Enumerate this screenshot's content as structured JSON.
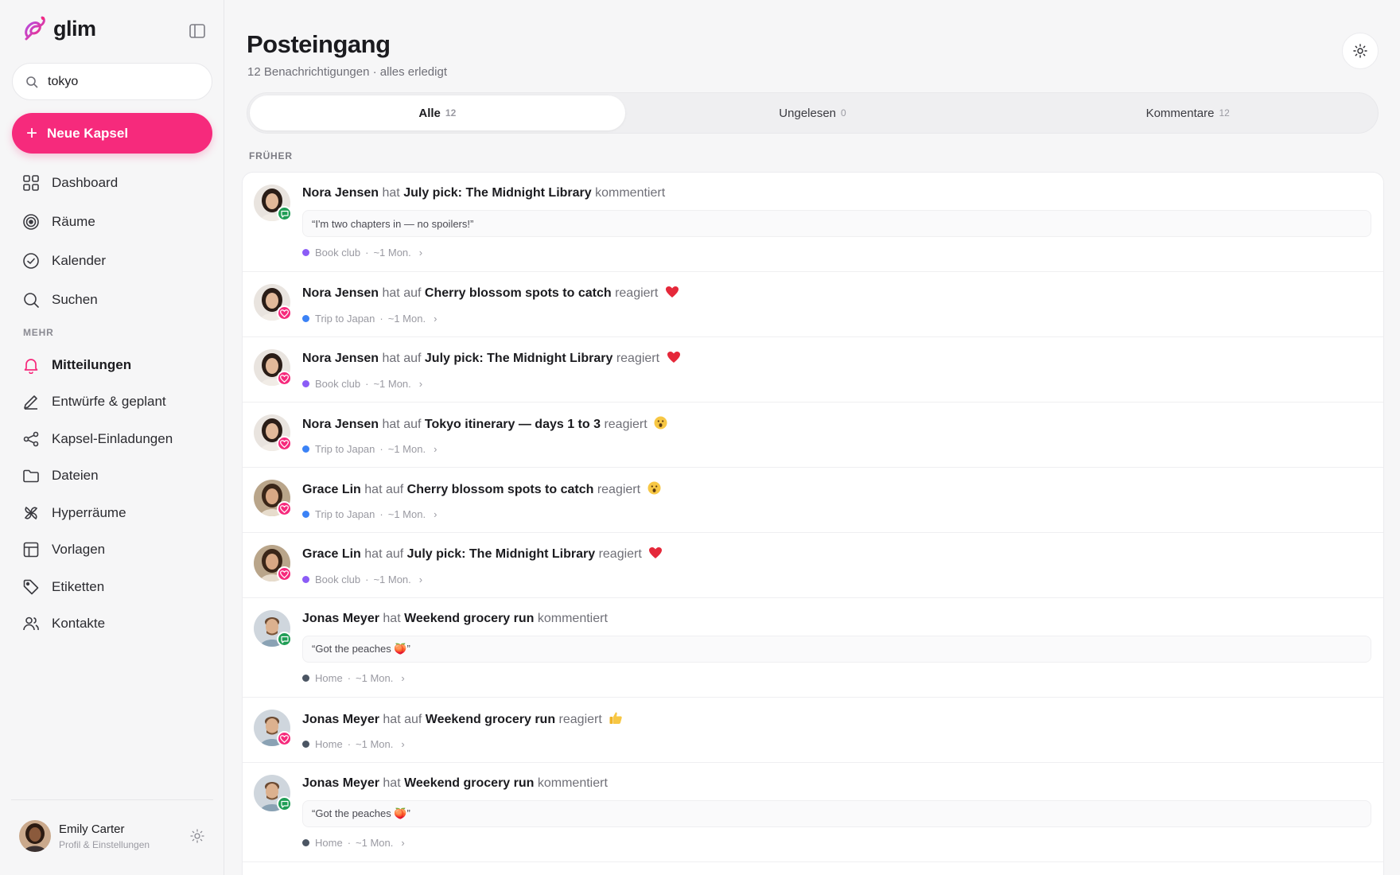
{
  "sidebar": {
    "brand": "glim",
    "search_value": "tokyo",
    "new_label": "Neue Kapsel",
    "items_main": [
      {
        "label": "Dashboard",
        "icon": "grid-icon"
      },
      {
        "label": "Räume",
        "icon": "target-icon"
      },
      {
        "label": "Kalender",
        "icon": "check-circle-icon"
      },
      {
        "label": "Suchen",
        "icon": "search-icon"
      }
    ],
    "section_more": "MEHR",
    "items_more": [
      {
        "label": "Mitteilungen",
        "icon": "bell-icon",
        "active": true
      },
      {
        "label": "Entwürfe & geplant",
        "icon": "pen-icon"
      },
      {
        "label": "Kapsel-Einladungen",
        "icon": "share-icon"
      },
      {
        "label": "Dateien",
        "icon": "folder-icon"
      },
      {
        "label": "Hyperräume",
        "icon": "pinwheel-icon"
      },
      {
        "label": "Vorlagen",
        "icon": "template-icon"
      },
      {
        "label": "Etiketten",
        "icon": "tag-icon"
      },
      {
        "label": "Kontakte",
        "icon": "users-icon"
      }
    ],
    "profile": {
      "name": "Emily Carter",
      "subtitle": "Profil & Einstellungen"
    }
  },
  "main": {
    "title": "Posteingang",
    "subtitle": "12 Benachrichtigungen · alles erledigt",
    "tabs": [
      {
        "label": "Alle",
        "count": "12",
        "active": true
      },
      {
        "label": "Ungelesen",
        "count": "0"
      },
      {
        "label": "Kommentare",
        "count": "12"
      }
    ],
    "group_label": "FRÜHER",
    "notifications": [
      {
        "type": "comment",
        "actor": "Nora Jensen",
        "verb_pre": "hat",
        "target": "July pick: The Midnight Library",
        "verb_post": "kommentiert",
        "emoji": "",
        "quote": "“I'm two chapters in — no spoilers!”",
        "space": "Book club",
        "space_color": "#8b5cf6",
        "time": "~1 Mon.",
        "person": "nora"
      },
      {
        "type": "react",
        "actor": "Nora Jensen",
        "verb_pre": "hat auf",
        "target": "Cherry blossom spots to catch",
        "verb_post": "reagiert",
        "emoji": "heart",
        "space": "Trip to Japan",
        "space_color": "#3b82f6",
        "time": "~1 Mon.",
        "person": "nora"
      },
      {
        "type": "react",
        "actor": "Nora Jensen",
        "verb_pre": "hat auf",
        "target": "July pick: The Midnight Library",
        "verb_post": "reagiert",
        "emoji": "heart",
        "space": "Book club",
        "space_color": "#8b5cf6",
        "time": "~1 Mon.",
        "person": "nora"
      },
      {
        "type": "react",
        "actor": "Nora Jensen",
        "verb_pre": "hat auf",
        "target": "Tokyo itinerary — days 1 to 3",
        "verb_post": "reagiert",
        "emoji": "wow",
        "space": "Trip to Japan",
        "space_color": "#3b82f6",
        "time": "~1 Mon.",
        "person": "nora"
      },
      {
        "type": "react",
        "actor": "Grace Lin",
        "verb_pre": "hat auf",
        "target": "Cherry blossom spots to catch",
        "verb_post": "reagiert",
        "emoji": "wow",
        "space": "Trip to Japan",
        "space_color": "#3b82f6",
        "time": "~1 Mon.",
        "person": "grace"
      },
      {
        "type": "react",
        "actor": "Grace Lin",
        "verb_pre": "hat auf",
        "target": "July pick: The Midnight Library",
        "verb_post": "reagiert",
        "emoji": "heart",
        "space": "Book club",
        "space_color": "#8b5cf6",
        "time": "~1 Mon.",
        "person": "grace"
      },
      {
        "type": "comment",
        "actor": "Jonas Meyer",
        "verb_pre": "hat",
        "target": "Weekend grocery run",
        "verb_post": "kommentiert",
        "emoji": "",
        "quote": "“Got the peaches 🍑”",
        "space": "Home",
        "space_color": "#4b5563",
        "time": "~1 Mon.",
        "person": "jonas"
      },
      {
        "type": "react",
        "actor": "Jonas Meyer",
        "verb_pre": "hat auf",
        "target": "Weekend grocery run",
        "verb_post": "reagiert",
        "emoji": "thumbs",
        "space": "Home",
        "space_color": "#4b5563",
        "time": "~1 Mon.",
        "person": "jonas"
      },
      {
        "type": "comment",
        "actor": "Jonas Meyer",
        "verb_pre": "hat",
        "target": "Weekend grocery run",
        "verb_post": "kommentiert",
        "emoji": "",
        "quote": "“Got the peaches 🍑”",
        "space": "Home",
        "space_color": "#4b5563",
        "time": "~1 Mon.",
        "person": "jonas"
      }
    ]
  },
  "colors": {
    "accent": "#f62a7c",
    "reaction_badge": "#f62a7c",
    "comment_badge": "#1f9d55"
  }
}
